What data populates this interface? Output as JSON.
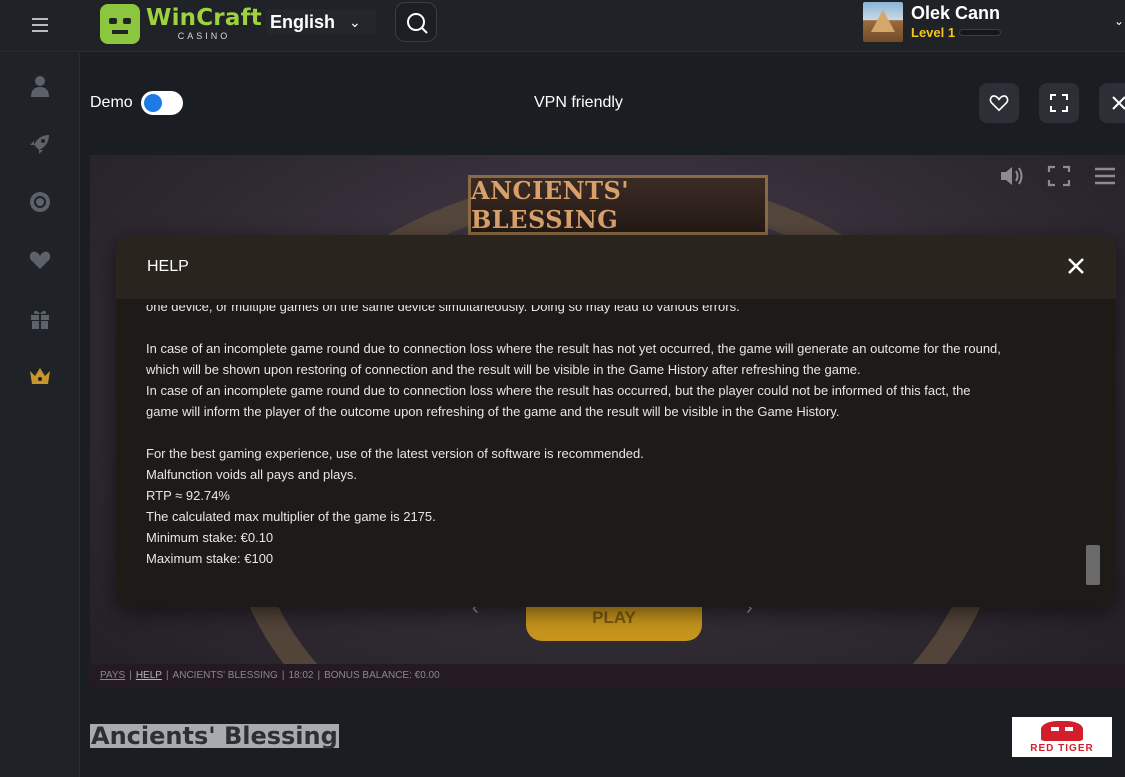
{
  "header": {
    "logo_name": "WinCraft",
    "logo_sub": "CASINO",
    "language": "English",
    "user": {
      "name": "Olek Cann",
      "level": "Level 1",
      "level_progress": 0
    }
  },
  "sidebar": {
    "items": [
      {
        "icon": "user-icon"
      },
      {
        "icon": "rocket-icon"
      },
      {
        "icon": "live-casino-icon"
      },
      {
        "icon": "heart-icon"
      },
      {
        "icon": "gift-icon"
      },
      {
        "icon": "crown-icon"
      }
    ]
  },
  "game_bar": {
    "demo_label": "Demo",
    "demo_enabled": true,
    "vpn_label": "VPN friendly"
  },
  "game": {
    "title_plate": "ANCIENTS' BLESSING",
    "play_label": "PLAY",
    "status": {
      "pays": "PAYS",
      "help": "HELP",
      "game": "ANCIENTS' BLESSING",
      "time": "18:02",
      "bonus": "BONUS BALANCE: €0.00",
      "sep": "|"
    }
  },
  "help": {
    "title": "HELP",
    "lines": [
      "one device, or multiple games on the same device simultaneously. Doing so may lead to various errors.",
      "",
      "In case of an incomplete game round due to connection loss where the result has not yet occurred, the game will generate an outcome for the round,",
      "which will be shown upon restoring of connection and the result will be visible in the Game History after refreshing the game.",
      "In case of an incomplete game round due to connection loss where the result has occurred, but the player could not be informed of this fact, the",
      "game will inform the player of the outcome upon refreshing of the game and the result will be visible in the Game History.",
      "",
      "For the best gaming experience, use of the latest version of software is recommended.",
      "Malfunction voids all pays and plays.",
      "RTP ≈ 92.74%",
      "The calculated max multiplier of the game is 2175.",
      "Minimum stake: €0.10",
      "Maximum stake: €100"
    ]
  },
  "footer": {
    "game_name": "Ancients' Blessing",
    "provider": "RED TIGER"
  },
  "colors": {
    "accent_green": "#9ed33f",
    "level_yellow": "#f5c518",
    "toggle_blue": "#1e7be6",
    "provider_red": "#d21f2b"
  }
}
